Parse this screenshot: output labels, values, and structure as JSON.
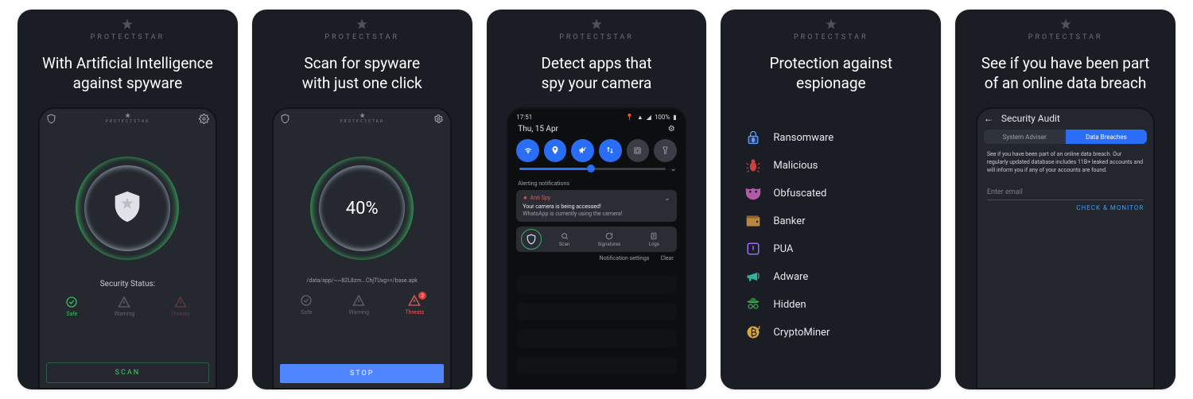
{
  "brand": "PROTECTSTAR",
  "cards": [
    {
      "headline": "With Artificial Intelligence\nagainst spyware",
      "phone": {
        "status_label": "Security Status:",
        "chips": {
          "safe": "Safe",
          "warning": "Warning",
          "threats": "Threats"
        },
        "cta": "SCAN"
      }
    },
    {
      "headline": "Scan for spyware\nwith just one click",
      "phone": {
        "progress": "40%",
        "path": "/data/app/~~82L8zm...ChjTUxg==/base.apk",
        "chips": {
          "safe": "Safe",
          "warning": "Warning",
          "threats": "Threats"
        },
        "threat_badge": "2",
        "cta": "STOP"
      }
    },
    {
      "headline": "Detect apps that\nspy your camera",
      "phone": {
        "time": "17:51",
        "battery": "100%",
        "date": "Thu, 15 Apr",
        "alert_header": "Alerting notifications",
        "notif_app": "Anti Spy",
        "notif_title": "Your camera is being accessed!",
        "notif_body": "WhatsApp is currently using the camera!",
        "actions": {
          "scan": "Scan",
          "signatures": "Signatures",
          "logs": "Logs"
        },
        "footer": {
          "settings": "Notification settings",
          "clear": "Clear"
        }
      }
    },
    {
      "headline": "Protection against\nespionage",
      "threats": [
        "Ransomware",
        "Malicious",
        "Obfuscated",
        "Banker",
        "PUA",
        "Adware",
        "Hidden",
        "CryptoMiner"
      ]
    },
    {
      "headline": "See if you have been part\nof an online data breach",
      "phone": {
        "title": "Security Audit",
        "tabs": {
          "adviser": "System Adviser",
          "breaches": "Data Breaches"
        },
        "desc": "See if you have been part of an online data breach. Our regularly updated database includes 11B+ leaked accounts and will inform you if any of your accounts are found.",
        "placeholder": "Enter email",
        "cta": "CHECK & MONITOR"
      }
    }
  ]
}
